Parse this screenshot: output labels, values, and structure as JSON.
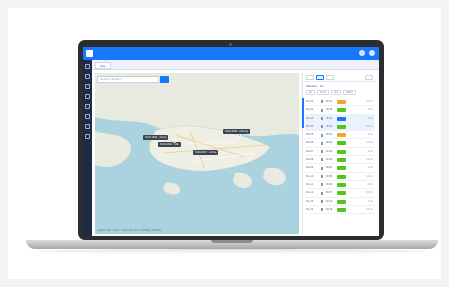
{
  "app": {
    "tab_label": "Map",
    "search_placeholder": "Search vehicle  ▾",
    "map_attribution": "Leaflet | Tiles © Esri — Esri, DeLorme, NAVTEQ, TomTom",
    "brand_color": "#1677ff"
  },
  "map": {
    "labels": [
      {
        "text": "SGN-1482 · Active"
      },
      {
        "text": "SGN-2031 · Idle"
      },
      {
        "text": "SGN-0917 · Active"
      },
      {
        "text": "SGN-3350 · Moving"
      }
    ]
  },
  "panel": {
    "title": "Vehicles · 12",
    "filters": [
      "All",
      "Active",
      "Idle",
      "Offline"
    ],
    "rows": [
      {
        "id": "SG-01",
        "time": "08:12",
        "status_color": "#f5a623",
        "value": "12 km"
      },
      {
        "id": "SG-02",
        "time": "08:15",
        "status_color": "#52c41a",
        "value": "8 km"
      },
      {
        "id": "SG-03",
        "time": "08:20",
        "status_color": "#1677ff",
        "value": "5 km"
      },
      {
        "id": "SG-04",
        "time": "08:22",
        "status_color": "#52c41a",
        "value": "21 km"
      },
      {
        "id": "SG-05",
        "time": "08:31",
        "status_color": "#f5a623",
        "value": "3 km"
      },
      {
        "id": "SG-06",
        "time": "08:34",
        "status_color": "#52c41a",
        "value": "17 km"
      },
      {
        "id": "SG-07",
        "time": "08:40",
        "status_color": "#52c41a",
        "value": "9 km"
      },
      {
        "id": "SG-08",
        "time": "08:46",
        "status_color": "#52c41a",
        "value": "14 km"
      },
      {
        "id": "SG-09",
        "time": "08:51",
        "status_color": "#52c41a",
        "value": "6 km"
      },
      {
        "id": "SG-10",
        "time": "08:55",
        "status_color": "#52c41a",
        "value": "11 km"
      },
      {
        "id": "SG-11",
        "time": "09:02",
        "status_color": "#52c41a",
        "value": "2 km"
      },
      {
        "id": "SG-12",
        "time": "09:07",
        "status_color": "#52c41a",
        "value": "19 km"
      },
      {
        "id": "SG-13",
        "time": "09:12",
        "status_color": "#52c41a",
        "value": "7 km"
      },
      {
        "id": "SG-14",
        "time": "09:18",
        "status_color": "#52c41a",
        "value": "15 km"
      }
    ]
  },
  "icons": {
    "sidebar": [
      "dashboard-icon",
      "map-icon",
      "vehicle-icon",
      "route-icon",
      "report-icon",
      "alert-icon",
      "settings-icon",
      "user-icon"
    ],
    "topbar": [
      "bell-icon",
      "user-icon"
    ]
  }
}
